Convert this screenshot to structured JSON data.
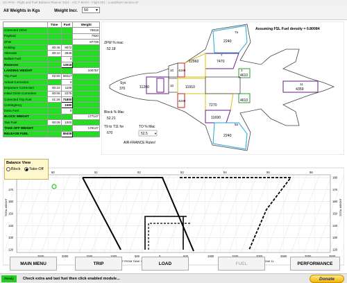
{
  "window": {
    "title": "CC-PAS - Flight and Fuel Balance Planner 2021 - A/C F-BVFA - Flight 001 - Loadsheet Version AF"
  },
  "header": {
    "weights_label": "All Weights in Kgs",
    "incr_label": "Weight Incr.",
    "incr_value": "50"
  },
  "table": {
    "headers": [
      "",
      "Time",
      "Fuel",
      "Weight"
    ],
    "rows": [
      {
        "name": "Corrected DOW",
        "time": "",
        "fuel": "",
        "weight": "79819"
      },
      {
        "name": "Payload",
        "time": "",
        "fuel": "",
        "weight": "7920"
      },
      {
        "name": "ZFW",
        "time": "",
        "fuel": "",
        "weight": "87739"
      },
      {
        "name": "Holding",
        "time": "00:45",
        "fuel": "9072",
        "weight": ""
      },
      {
        "name": "Alternate",
        "time": "00:10",
        "fuel": "3946",
        "weight": ""
      },
      {
        "name": "Ballast Fuel",
        "time": "",
        "fuel": "0",
        "weight": ""
      },
      {
        "name": "Reserves",
        "time": "",
        "fuel": "13018",
        "weight": ""
      },
      {
        "name": "LANDING WEIGHT",
        "time": "",
        "fuel": "",
        "weight": "100757"
      },
      {
        "name": "Trip Fuel",
        "time": "02:60",
        "fuel": "68417",
        "weight": ""
      },
      {
        "name": "Arrival Correction",
        "time": "",
        "fuel": "0",
        "weight": ""
      },
      {
        "name": "Departure Correction",
        "time": "00:22",
        "fuel": "1108",
        "weight": ""
      },
      {
        "name": "Initial Climb Correction",
        "time": "00:05",
        "fuel": "2275",
        "weight": ""
      },
      {
        "name": "Corrected Trip Fuel",
        "time": "01:26",
        "fuel": "71800",
        "weight": ""
      },
      {
        "name": "Contingency",
        "time": "",
        "fuel": "1590",
        "weight": ""
      },
      {
        "name": "Extra Fuel",
        "time": "",
        "fuel": "0",
        "weight": ""
      },
      {
        "name": "BLOCK WEIGHT",
        "time": "",
        "fuel": "",
        "weight": "177147"
      },
      {
        "name": "Taxi Fuel",
        "time": "00:09",
        "fuel": "1000",
        "weight": ""
      },
      {
        "name": "TAKE OFF WEIGHT",
        "time": "",
        "fuel": "",
        "weight": "176147"
      },
      {
        "name": "RELEASE FUEL",
        "time": "",
        "fuel": "89408",
        "weight": ""
      }
    ]
  },
  "plane": {
    "density_note": "Assuming FSL Fuel density = 0.80084",
    "zfw_mac_label": "ZFW % mac",
    "zfw_mac_value": "52.18",
    "block_mac_label": "Block % Mac",
    "block_mac_value": "52.21",
    "t9_label": "T9 to T11 for",
    "t9_value": "670",
    "to_mac_label": "TO % Mac",
    "to_mac_value": "52.5",
    "airfrance": "AIR-FRANCE Rules!",
    "tanks": [
      {
        "id": "7a",
        "value": "2240"
      },
      {
        "id": "7",
        "value": "7470"
      },
      {
        "id": "10",
        "value": "12960"
      },
      {
        "id": "3",
        "value": "4610"
      },
      {
        "id": "9",
        "value": "10"
      },
      {
        "id": "4",
        "value": "4240"
      },
      {
        "id": "5ys",
        "value": "370"
      },
      {
        "id": "9b",
        "value": "11200"
      },
      {
        "id": "10b",
        "value": "10"
      },
      {
        "id": "10c",
        "value": "11910"
      },
      {
        "id": "11",
        "value": "4359"
      },
      {
        "id": "1",
        "value": "4240"
      },
      {
        "id": "2",
        "value": "4610"
      },
      {
        "id": "5",
        "value": "7270"
      },
      {
        "id": "6",
        "value": "11690"
      },
      {
        "id": "5a",
        "value": "2240"
      }
    ]
  },
  "balance": {
    "title": "Balance View",
    "block": "Block",
    "takeoff": "Take-Off"
  },
  "chart": {
    "y_ticks": [
      "180",
      "170",
      "160",
      "150",
      "140",
      "130",
      "120"
    ],
    "top_ticks": [
      "50",
      "51",
      "52",
      "53",
      "54",
      "55",
      "56"
    ],
    "bottom_ticks": [
      "2500",
      "2000",
      "1500",
      "1000",
      "500",
      "0",
      "500",
      "1000",
      "1500",
      "2000",
      "2500",
      "3000",
      "3500"
    ],
    "x_label_left": "PRE TAKE OFF TRANSFERT FROM TANK 9 TO TANK 11 (Kg)",
    "x_label_right": "PRE TAKE OFF BURN FROM TANK 11",
    "ylabel_left": "TOTAL WEIGHT",
    "ylabel_right": "TOTAL WEIGHT"
  },
  "buttons": {
    "main_menu": "MAIN MENU",
    "trip": "TRIP",
    "load": "LOAD",
    "fuel": "FUEL",
    "performance": "PERFORMANCE"
  },
  "status": {
    "ready": "Ready",
    "message": "Check extra and taxi fuel then click enabled module...",
    "donate": "Donate"
  }
}
